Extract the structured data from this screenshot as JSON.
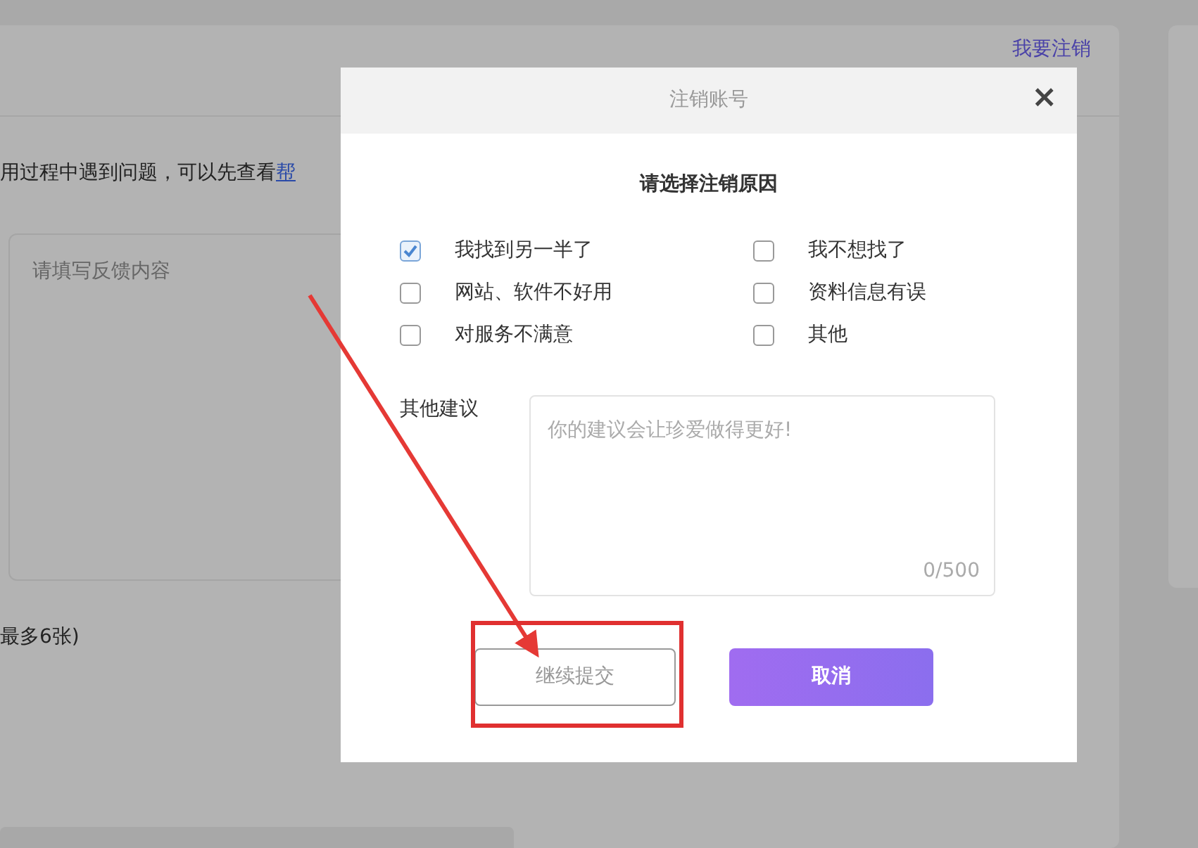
{
  "background": {
    "cancel_link": "我要注销",
    "notice": "用过程中遇到问题，可以先查看",
    "help_link": "帮",
    "feedback_placeholder": "请填写反馈内容",
    "upload_note": "最多6张)"
  },
  "dialog": {
    "title": "注销账号",
    "close": "×",
    "heading": "请选择注销原因",
    "reasons": [
      {
        "label": "我找到另一半了",
        "checked": true
      },
      {
        "label": "我不想找了",
        "checked": false
      },
      {
        "label": "网站、软件不好用",
        "checked": false
      },
      {
        "label": "资料信息有误",
        "checked": false
      },
      {
        "label": "对服务不满意",
        "checked": false
      },
      {
        "label": "其他",
        "checked": false
      }
    ],
    "suggestion_label": "其他建议",
    "suggestion_placeholder": "你的建议会让珍爱做得更好!",
    "counter": "0/500",
    "buttons": [
      {
        "label": "继续提交",
        "kind": "secondary"
      },
      {
        "label": "取消",
        "kind": "primary"
      }
    ]
  }
}
